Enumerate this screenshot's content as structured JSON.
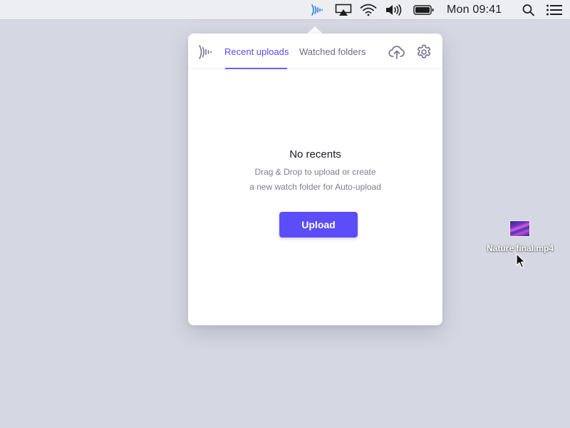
{
  "menubar": {
    "clock": "Mon 09:41",
    "icons": [
      "app-waves-icon",
      "airplay-icon",
      "wifi-icon",
      "volume-icon",
      "battery-icon",
      "search-icon",
      "list-icon"
    ]
  },
  "popover": {
    "tabs": [
      {
        "label": "Recent uploads",
        "active": true
      },
      {
        "label": "Watched folders",
        "active": false
      }
    ],
    "header_icons": [
      "logo-waves-icon",
      "upload-cloud-icon",
      "gear-icon"
    ],
    "empty_state": {
      "title": "No recents",
      "line1": "Drag & Drop to upload or create",
      "line2": "a new watch folder for Auto-upload"
    },
    "upload_button": "Upload"
  },
  "desktop": {
    "file_name": "Nature final.mp4"
  },
  "colors": {
    "accent": "#5b4df8",
    "desktop": "#d5d8e2",
    "menubar": "#eceef2"
  }
}
